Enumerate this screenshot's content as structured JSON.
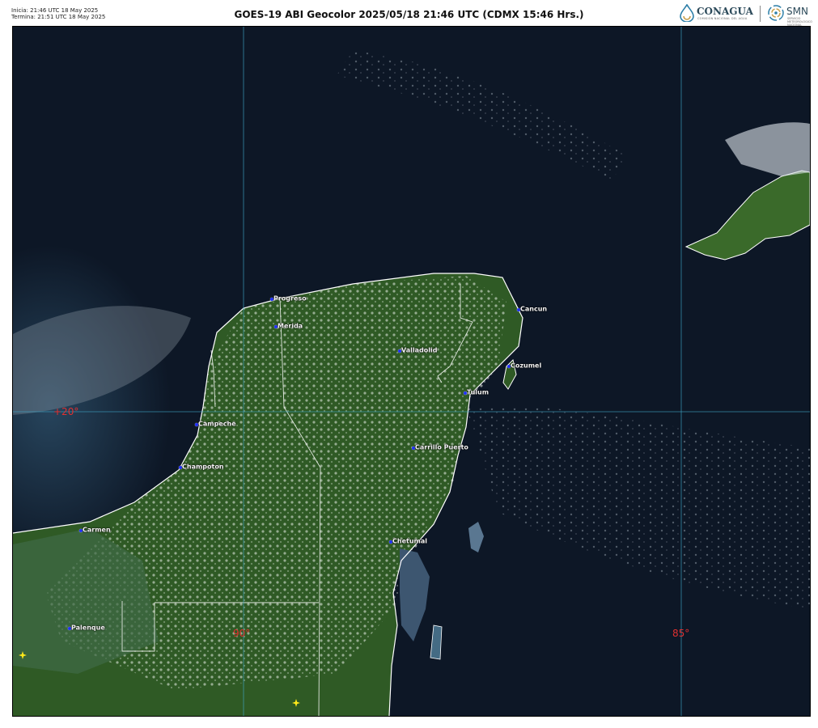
{
  "header": {
    "start_info": "Inicia: 21:46 UTC 18 May 2025",
    "end_info": "Termina: 21:51 UTC 18 May 2025",
    "title": "GOES-19 ABI Geocolor 2025/05/18 21:46 UTC (CDMX  15:46 Hrs.)"
  },
  "logos": {
    "conagua": {
      "name": "CONAGUA",
      "subtitle": "COMISIÓN NACIONAL DEL AGUA"
    },
    "smn": {
      "name": "SMN",
      "subtitle": "SERVICIO METEOROLÓGICO NACIONAL"
    }
  },
  "map": {
    "colors": {
      "ocean": "#0d1726",
      "land": "#2f5a25",
      "land_dark": "#24471c",
      "coast": "#ffffff",
      "grid": "#3fa7c8",
      "coord_label": "#e03030",
      "city_marker": "#2030ff",
      "fire": "#ffe81a"
    },
    "gridlines": {
      "latitudes": [
        "+20°"
      ],
      "longitudes": [
        "90°",
        "85°"
      ]
    },
    "cities": [
      {
        "name": "Progreso",
        "id": "progreso"
      },
      {
        "name": "Merida",
        "id": "merida"
      },
      {
        "name": "Valladolid",
        "id": "valladolid"
      },
      {
        "name": "Cancun",
        "id": "cancun"
      },
      {
        "name": "Cozumel",
        "id": "cozumel"
      },
      {
        "name": "Tulum",
        "id": "tulum"
      },
      {
        "name": "Campeche",
        "id": "campeche"
      },
      {
        "name": "Carrillo Puerto",
        "id": "carrillo-puerto"
      },
      {
        "name": "Champoton",
        "id": "champoton"
      },
      {
        "name": "Carmen",
        "id": "carmen"
      },
      {
        "name": "Chetumal",
        "id": "chetumal"
      },
      {
        "name": "Palenque",
        "id": "palenque"
      }
    ],
    "hotspots": [
      {
        "id": "fire-1",
        "icon": "fire-icon"
      },
      {
        "id": "fire-2",
        "icon": "fire-icon"
      }
    ]
  }
}
